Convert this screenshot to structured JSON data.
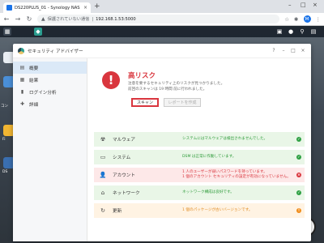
{
  "browser": {
    "tab_title": "DS220PLUS_01 - Synology NAS",
    "tab_close": "×",
    "new_tab": "+",
    "security_warning": "保護されていない通信",
    "url": "192.168.1.53:5000",
    "profile_initial": "M",
    "window_controls": [
      "–",
      "□",
      "×"
    ]
  },
  "window": {
    "title": "セキュリティ アドバイザー",
    "controls": [
      "?",
      "–",
      "□",
      "×"
    ]
  },
  "sidebar": {
    "items": [
      {
        "label": "概要",
        "icon": "overview-icon",
        "glyph": "▤",
        "active": true
      },
      {
        "label": "結果",
        "icon": "results-icon",
        "glyph": "▦",
        "active": false
      },
      {
        "label": "ログイン分析",
        "icon": "login-analysis-icon",
        "glyph": "▮",
        "active": false
      },
      {
        "label": "詳細",
        "icon": "advanced-icon",
        "glyph": "✚",
        "active": false
      }
    ]
  },
  "summary": {
    "status_glyph": "!",
    "status_title": "高リスク",
    "desc_line1": "注意を要するセキュリティ上のリスクが見つかりました。",
    "desc_line2": "前回のスキャンは 19 時間 前に行われました。",
    "scan_button": "スキャン",
    "report_button": "レポートを作成"
  },
  "categories": [
    {
      "label": "マルウェア",
      "icon": "malware-icon",
      "glyph": "☢",
      "message": "システムにはマルウェアは検出されませんでした。",
      "message2": "",
      "status": "ok",
      "status_glyph": "✓"
    },
    {
      "label": "システム",
      "icon": "system-icon",
      "glyph": "▭",
      "message": "DSM は正常に作動しています。",
      "message2": "",
      "status": "ok",
      "status_glyph": "✓"
    },
    {
      "label": "アカウント",
      "icon": "account-icon",
      "glyph": "👤",
      "message": "1 人のユーザーが弱いパスワードを持っています。",
      "message2": "1 個のアカウント セキュリティの設定が有効になっていません。",
      "status": "bad",
      "status_glyph": "×"
    },
    {
      "label": "ネットワーク",
      "icon": "network-icon",
      "glyph": "⌂",
      "message": "ネットワーク構成は良好です。",
      "message2": "",
      "status": "ok",
      "status_glyph": "✓"
    },
    {
      "label": "更新",
      "icon": "update-icon",
      "glyph": "↻",
      "message": "1 個のパッケージが古いバージョンです。",
      "message2": "",
      "status": "warn",
      "status_glyph": "!"
    }
  ],
  "desktop": {
    "labels": [
      "コン",
      "Fi",
      "DS"
    ],
    "search_glyph": "⚲"
  },
  "colors": {
    "danger": "#d9363e",
    "ok": "#2ea043",
    "warn": "#f08c1a",
    "accent": "#1a73e8"
  }
}
